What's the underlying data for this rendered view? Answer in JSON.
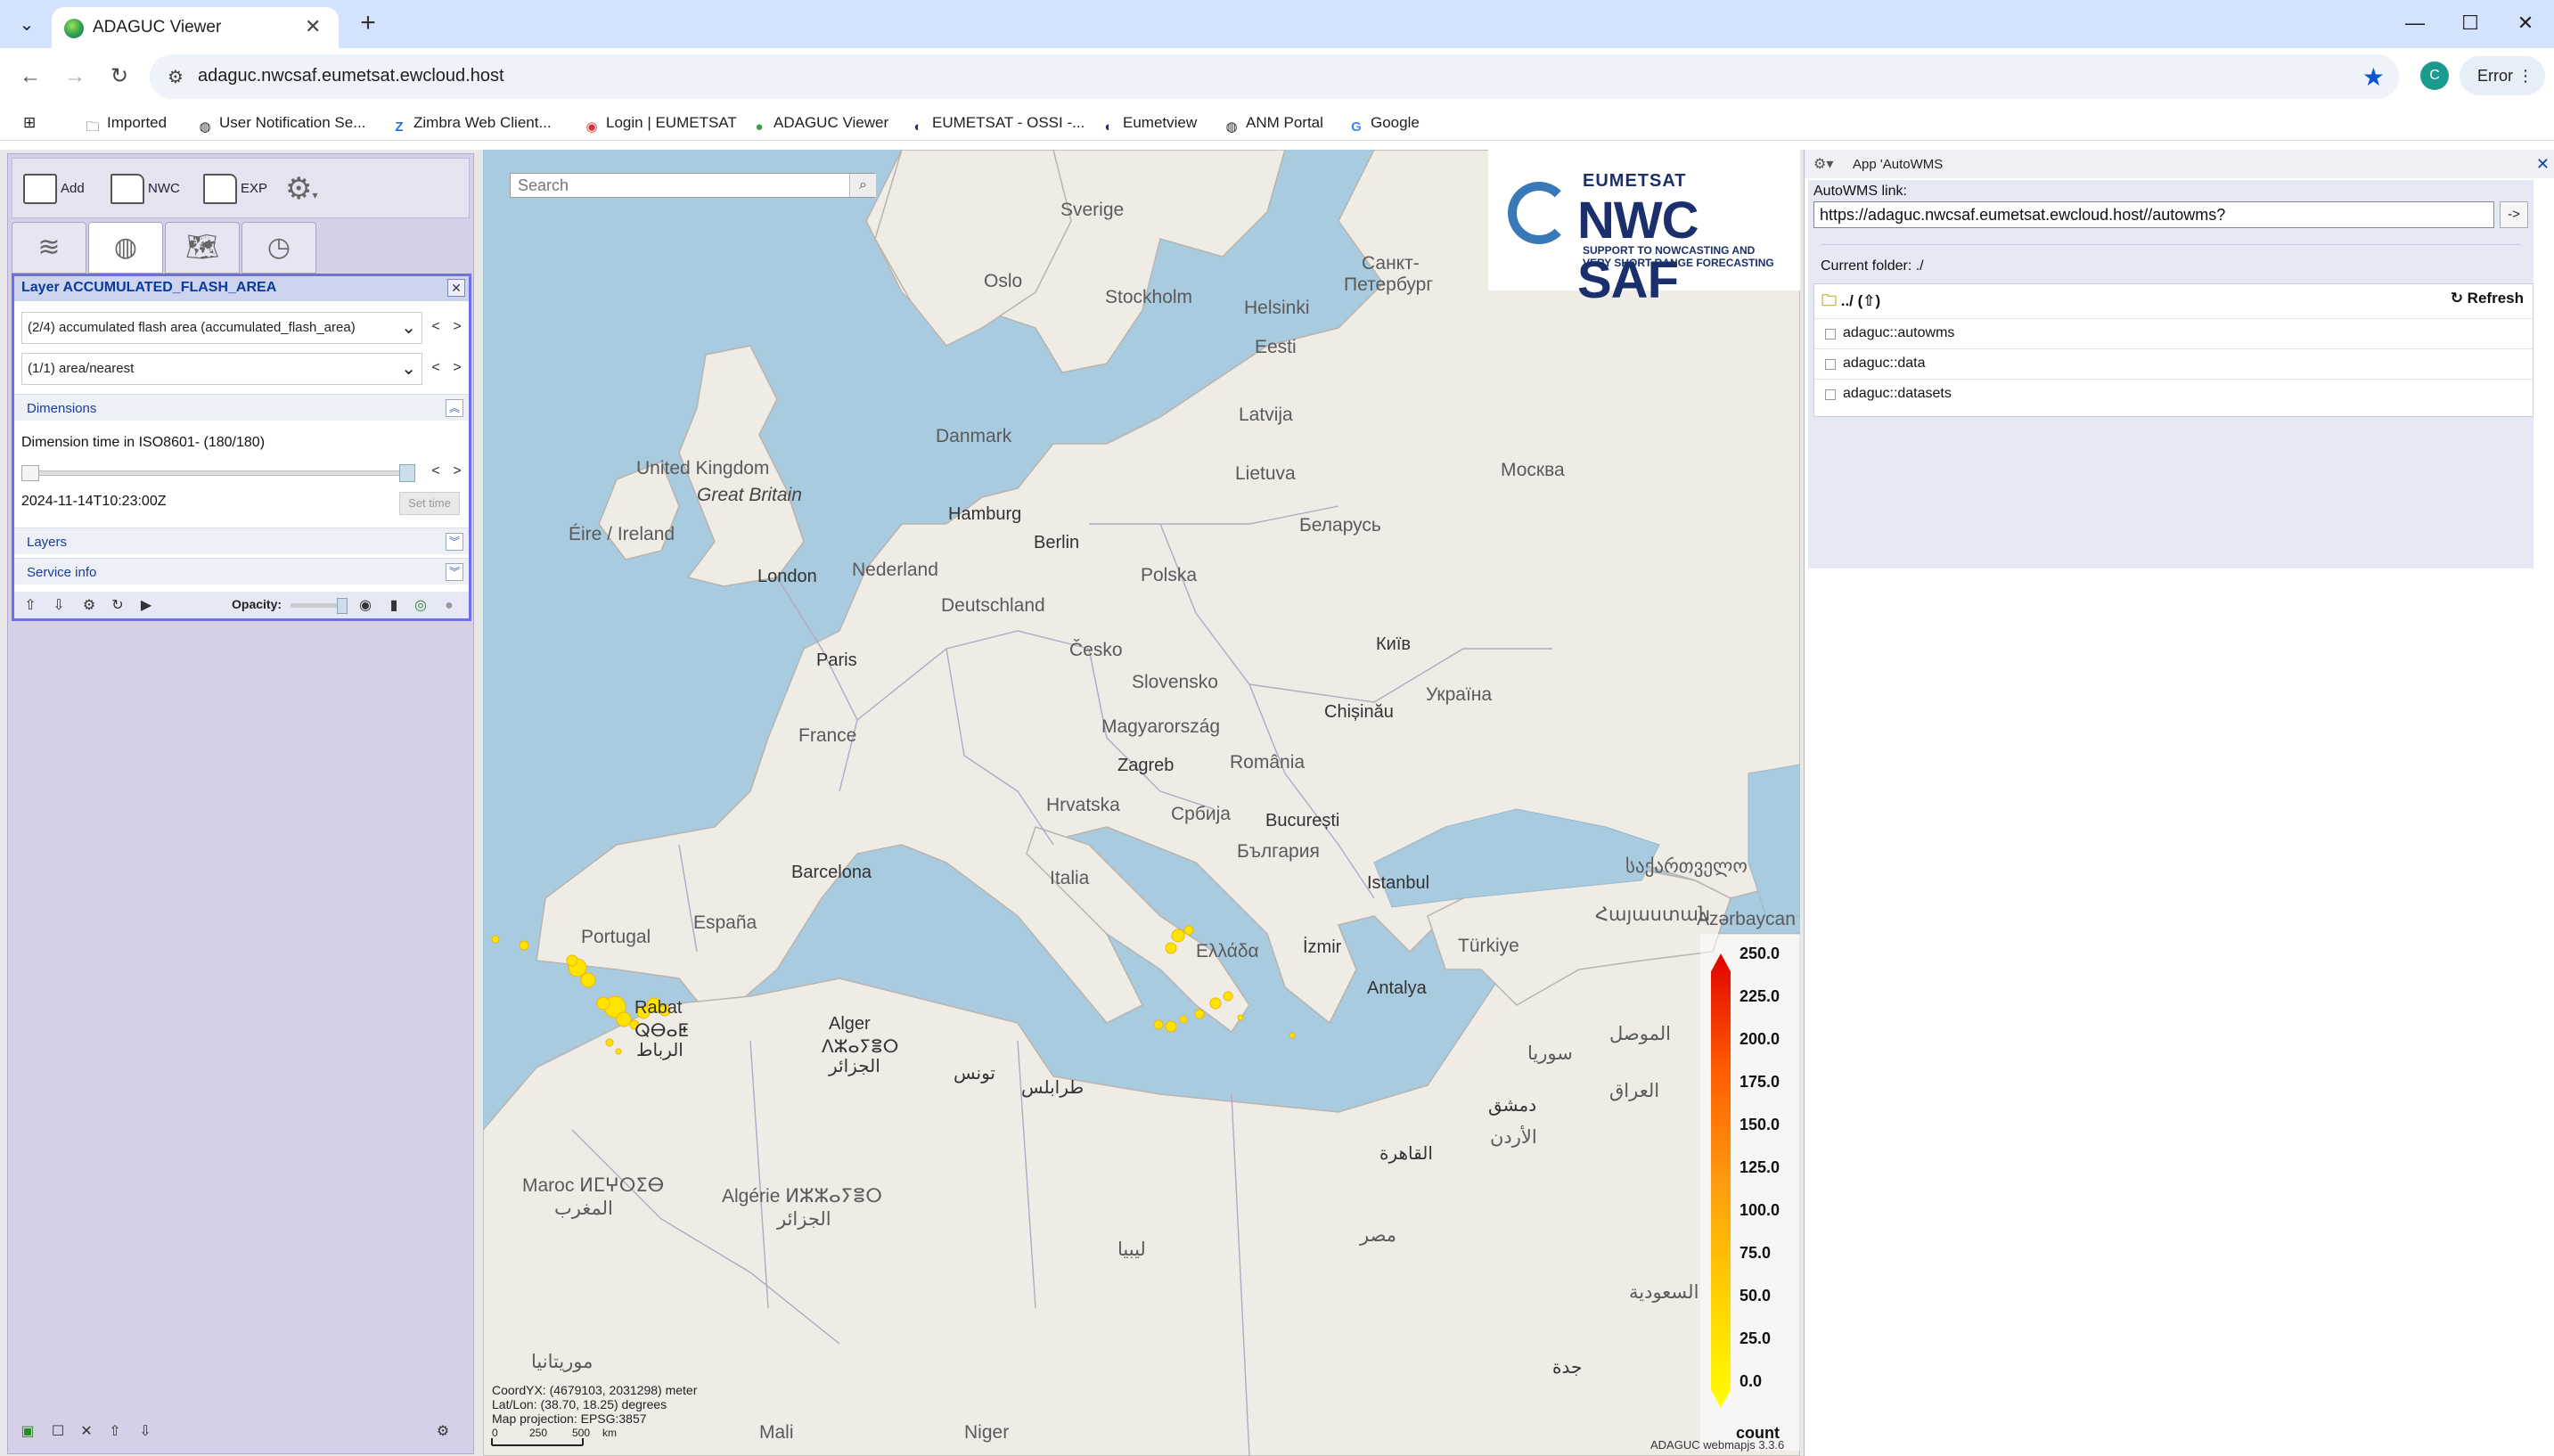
{
  "browser": {
    "tab_title": "ADAGUC Viewer",
    "url": "adaguc.nwcsaf.eumetsat.ewcloud.host",
    "profile_initial": "C",
    "error_label": "Error",
    "bookmarks": [
      "Imported",
      "User Notification Se...",
      "Zimbra Web Client...",
      "Login | EUMETSAT",
      "ADAGUC Viewer",
      "EUMETSAT - OSSI -...",
      "Eumetview",
      "ANM Portal",
      "Google"
    ]
  },
  "toolbar": {
    "add_label": "Add",
    "nwc_label": "NWC",
    "exp_label": "EXP"
  },
  "layer": {
    "title": "Layer ACCUMULATED_FLASH_AREA",
    "variable_select": "(2/4) accumulated flash area (accumulated_flash_area)",
    "style_select": "(1/1) area/nearest",
    "dimensions_label": "Dimensions",
    "dimension_text": "Dimension time in ISO8601- (180/180)",
    "time_value": "2024-11-14T10:23:00Z",
    "set_time_label": "Set time",
    "layers_label": "Layers",
    "service_info_label": "Service info",
    "opacity_label": "Opacity:",
    "time_slider_position": 1.0
  },
  "map": {
    "search_placeholder": "Search",
    "logo": {
      "org": "EUMETSAT",
      "name": "NWC SAF",
      "sub1": "SUPPORT TO NOWCASTING AND",
      "sub2": "VERY SHORT RANGE FORECASTING"
    },
    "labels": {
      "sverige": "Sverige",
      "oslo": "Oslo",
      "stockholm": "Stockholm",
      "helsinki": "Helsinki",
      "sankt": "Санкт-",
      "peterburg": "Петербург",
      "eesti": "Eesti",
      "latvija": "Latvija",
      "lietuva": "Lietuva",
      "moskva": "Москва",
      "danmark": "Danmark",
      "uk": "United Kingdom",
      "gb": "Great Britain",
      "ireland": "Éire / Ireland",
      "hamburg": "Hamburg",
      "berlin": "Berlin",
      "belarus": "Беларусь",
      "nederland": "Nederland",
      "polska": "Polska",
      "london": "London",
      "deutschland": "Deutschland",
      "paris": "Paris",
      "cesko": "Česko",
      "kyiv": "Київ",
      "slovensko": "Slovensko",
      "ukraina": "Україна",
      "chisinau": "Chișinău",
      "magyar": "Magyarország",
      "france": "France",
      "zagreb": "Zagreb",
      "romania": "România",
      "hrvatska": "Hrvatska",
      "srbija": "Србија",
      "bucuresti": "București",
      "bulgaria": "България",
      "barcelona": "Barcelona",
      "italia": "Italia",
      "istanbul": "Istanbul",
      "sakartvelo": "საქართველო",
      "portugal": "Portugal",
      "espana": "España",
      "hayastan": "Հայաստան",
      "azerbaycan": "Azərbaycan",
      "ellada": "Ελλάδα",
      "izmir": "İzmir",
      "turkiye": "Türkiye",
      "rabat": "Rabat",
      "rabat2": "ⵕⴱⴰⵟ",
      "rabat3": "الرباط",
      "alger": "Alger",
      "alger2": "ⴷⵣⴰⵢⴻⵔ",
      "alger3": "الجزائر",
      "tunis": "تونس",
      "antalya": "Antalya",
      "mosul": "الموصل",
      "surya": "سوريا",
      "iraq": "العراق",
      "tarabulus": "طرابلس",
      "dimashq": "دمشق",
      "urdun": "الأردن",
      "maroc": "Maroc ⵍⵎⵖⵔⵉⴱ",
      "maghrib": "المغرب",
      "algerie": "Algérie ⵍⵣⵣⴰⵢⴻⵔ",
      "algerie2": "الجزائر",
      "qahira": "القاهرة",
      "libya": "ليبيا",
      "misr": "مصر",
      "saudi": "السعودية",
      "jidda": "جدة",
      "mauritania": "موريتانيا",
      "mali": "Mali",
      "niger": "Niger"
    },
    "legend": {
      "ticks": [
        "250.0",
        "225.0",
        "200.0",
        "175.0",
        "150.0",
        "125.0",
        "100.0",
        "75.0",
        "50.0",
        "25.0",
        "0.0"
      ],
      "unit": "count",
      "colors": [
        "#e00000",
        "#ff5a00",
        "#ff9a10",
        "#ffd000",
        "#ffff00"
      ]
    },
    "coord_lines": [
      "CoordYX: (4679103, 2031298) meter",
      "Lat/Lon: (38.70, 18.25)  degrees",
      "Map projection: EPSG:3857"
    ],
    "scale_labels": [
      "0",
      "250",
      "500",
      "km"
    ],
    "version": "ADAGUC webmapjs 3.3.6"
  },
  "autowms": {
    "panel_title": "App 'AutoWMS",
    "link_label": "AutoWMS link:",
    "link_value": "https://adaguc.nwcsaf.eumetsat.ewcloud.host//autowms?",
    "go_label": "->",
    "current_folder": "Current folder: ./",
    "up_label": "../ (⇧)",
    "refresh_label": "↻ Refresh",
    "items": [
      "adaguc::autowms",
      "adaguc::data",
      "adaguc::datasets"
    ]
  }
}
